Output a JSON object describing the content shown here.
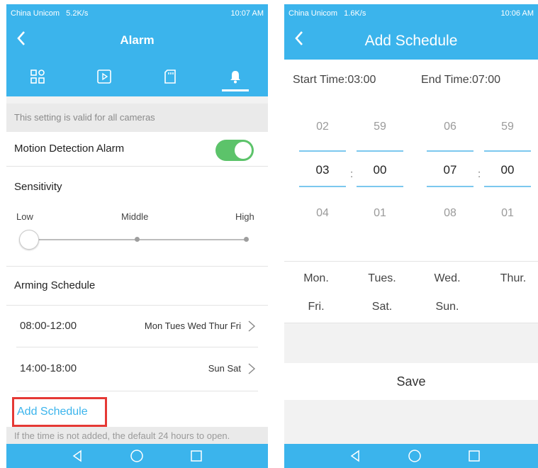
{
  "left": {
    "status": {
      "carrier": "China Unicom",
      "speed": "5.2K/s",
      "time": "10:07 AM"
    },
    "title": "Alarm",
    "tabs": [
      {
        "icon": "device-grid-icon"
      },
      {
        "icon": "play-icon"
      },
      {
        "icon": "sd-card-icon"
      },
      {
        "icon": "bell-icon",
        "active": true
      }
    ],
    "hint": "This setting is valid for all cameras",
    "motion_label": "Motion Detection Alarm",
    "motion_enabled": true,
    "sensitivity": {
      "title": "Sensitivity",
      "low": "Low",
      "middle": "Middle",
      "high": "High",
      "level": "Low"
    },
    "arming_title": "Arming Schedule",
    "schedules": [
      {
        "time": "08:00-12:00",
        "days": "Mon Tues Wed Thur Fri"
      },
      {
        "time": "14:00-18:00",
        "days": "Sun Sat"
      }
    ],
    "add_schedule": "Add Schedule",
    "footnote": "If the time is not added, the default 24 hours to open."
  },
  "right": {
    "status": {
      "carrier": "China Unicom",
      "speed": "1.6K/s",
      "time": "10:06 AM"
    },
    "title": "Add Schedule",
    "start_label": "Start Time:03:00",
    "end_label": "End Time:07:00",
    "start_hour": {
      "prev": "02",
      "selected": "03",
      "next": "04"
    },
    "start_min": {
      "prev": "59",
      "selected": "00",
      "next": "01"
    },
    "end_hour": {
      "prev": "06",
      "selected": "07",
      "next": "08"
    },
    "end_min": {
      "prev": "59",
      "selected": "00",
      "next": "01"
    },
    "separator": ":",
    "days": [
      "Mon.",
      "Tues.",
      "Wed.",
      "Thur.",
      "Fri.",
      "Sat.",
      "Sun."
    ],
    "save": "Save"
  },
  "colors": {
    "accent": "#3bb4ec",
    "toggle_on": "#5cc36a",
    "highlight": "#e53935"
  }
}
